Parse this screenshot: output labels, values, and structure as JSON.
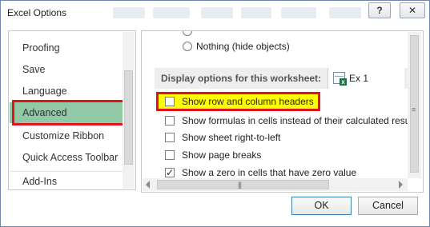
{
  "window": {
    "title": "Excel Options",
    "help_label": "?",
    "close_label": "✕"
  },
  "sidebar": {
    "items": [
      {
        "label": "Proofing"
      },
      {
        "label": "Save"
      },
      {
        "label": "Language"
      },
      {
        "label": "Advanced",
        "selected": true
      },
      {
        "label": "Customize Ribbon"
      },
      {
        "label": "Quick Access Toolbar"
      },
      {
        "label": "Add-Ins"
      }
    ]
  },
  "content": {
    "radio_nothing": "Nothing (hide objects)",
    "section_title": "Display options for this worksheet:",
    "sheet_selector": {
      "value": "Ex 1"
    },
    "options": [
      {
        "label": "Show row and column headers",
        "checked": false
      },
      {
        "label": "Show formulas in cells instead of their calculated results",
        "checked": false
      },
      {
        "label": "Show sheet right-to-left",
        "checked": false
      },
      {
        "label": "Show page breaks",
        "checked": false
      },
      {
        "label": "Show a zero in cells that have zero value",
        "checked": true
      }
    ]
  },
  "footer": {
    "ok_label": "OK",
    "cancel_label": "Cancel"
  },
  "colors": {
    "selected_nav": "#91c9a6",
    "highlight_border": "#e0141f",
    "highlight_fill": "#ffff00"
  }
}
